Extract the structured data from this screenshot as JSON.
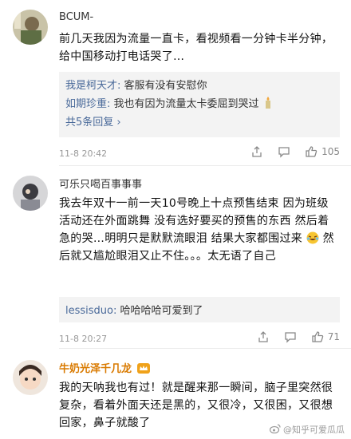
{
  "comments": [
    {
      "username": "BCUM-",
      "text": "前几天我因为流量一直卡，看视频看一分钟卡半分钟，给中国移动打电话哭了…",
      "replies": [
        {
          "author": "我是柯天才:",
          "text": " 客服有没有安慰你"
        },
        {
          "author": "如期珍重:",
          "text": " 我也有因为流量太卡委屈到哭过"
        }
      ],
      "more_replies": "共5条回复",
      "time": "11-8 20:42",
      "likes": "105"
    },
    {
      "username": "可乐只喝百事事事",
      "text_part1": "我去年双十一前一天10号晚上十点预售结束 因为班级活动还在外面跳舞 没有选好要买的预售的东西 然后着急的哭…明明只是默默流眼泪 结果大家都围过来",
      "text_part2": "然后就又尴尬眼泪又止不住。。。太无语了自己",
      "reply_author": "lessisduo:",
      "reply_text": " 哈哈哈哈可爱到了",
      "time": "11-8 20:27",
      "likes": "71"
    },
    {
      "username": "牛奶光泽千几龙",
      "text": "我的天呐我也有过！就是醒来那一瞬间，脑子里突然很复杂，看着外面天还是黑的，又很冷，又很困，又很想回家，鼻子就酸了"
    }
  ],
  "watermark": "@知乎可爱瓜瓜",
  "colors": {
    "link": "#4a6a9a",
    "gold": "#d97a00",
    "meta": "#999999"
  }
}
